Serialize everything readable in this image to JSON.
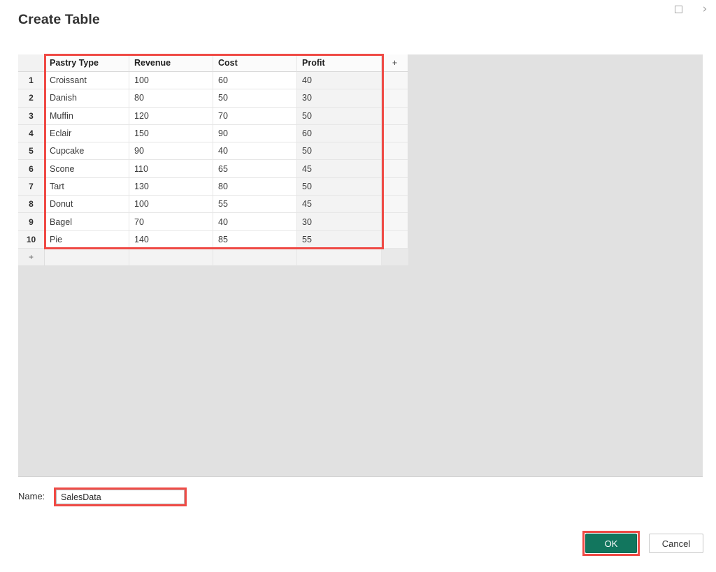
{
  "window": {
    "icons": [
      {
        "name": "maximize-icon",
        "glyph": "square"
      },
      {
        "name": "chevron-right-icon",
        "glyph": "›"
      }
    ]
  },
  "header": {
    "title": "Create Table"
  },
  "grid": {
    "row_number_header": "",
    "add_column_label": "+",
    "add_row_label": "+",
    "columns": [
      "Pastry Type",
      "Revenue",
      "Cost",
      "Profit"
    ],
    "rows": [
      {
        "n": "1",
        "pastry_type": "Croissant",
        "revenue": "100",
        "cost": "60",
        "profit": "40"
      },
      {
        "n": "2",
        "pastry_type": "Danish",
        "revenue": "80",
        "cost": "50",
        "profit": "30"
      },
      {
        "n": "3",
        "pastry_type": "Muffin",
        "revenue": "120",
        "cost": "70",
        "profit": "50"
      },
      {
        "n": "4",
        "pastry_type": "Eclair",
        "revenue": "150",
        "cost": "90",
        "profit": "60"
      },
      {
        "n": "5",
        "pastry_type": "Cupcake",
        "revenue": "90",
        "cost": "40",
        "profit": "50"
      },
      {
        "n": "6",
        "pastry_type": "Scone",
        "revenue": "110",
        "cost": "65",
        "profit": "45"
      },
      {
        "n": "7",
        "pastry_type": "Tart",
        "revenue": "130",
        "cost": "80",
        "profit": "50"
      },
      {
        "n": "8",
        "pastry_type": "Donut",
        "revenue": "100",
        "cost": "55",
        "profit": "45"
      },
      {
        "n": "9",
        "pastry_type": "Bagel",
        "revenue": "70",
        "cost": "40",
        "profit": "30"
      },
      {
        "n": "10",
        "pastry_type": "Pie",
        "revenue": "140",
        "cost": "85",
        "profit": "55"
      }
    ]
  },
  "name_field": {
    "label": "Name:",
    "value": "SalesData",
    "placeholder": ""
  },
  "footer": {
    "ok_label": "OK",
    "cancel_label": "Cancel"
  },
  "colors": {
    "accent_green": "#12765e",
    "annotation_red": "#ef4a45",
    "canvas_gray": "#e1e1e1",
    "selected_column_gray": "#f3f3f3"
  }
}
